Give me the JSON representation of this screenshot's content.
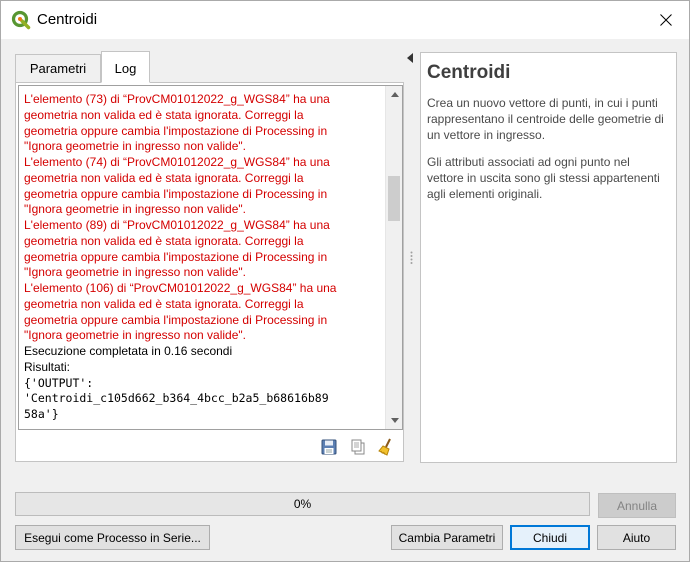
{
  "window": {
    "title": "Centroidi"
  },
  "tabs": [
    {
      "label": "Parametri"
    },
    {
      "label": "Log"
    }
  ],
  "log": {
    "lines": [
      {
        "text": "L'elemento (73) di “ProvCM01012022_g_WGS84” ha una",
        "style": "red"
      },
      {
        "text": "geometria non valida ed è stata ignorata. Correggi la",
        "style": "red"
      },
      {
        "text": "geometria oppure cambia l'impostazione di Processing in",
        "style": "red"
      },
      {
        "text": "\"Ignora geometrie in ingresso non valide\".",
        "style": "red"
      },
      {
        "text": "L'elemento (74) di “ProvCM01012022_g_WGS84” ha una",
        "style": "red"
      },
      {
        "text": "geometria non valida ed è stata ignorata. Correggi la",
        "style": "red"
      },
      {
        "text": "geometria oppure cambia l'impostazione di Processing in",
        "style": "red"
      },
      {
        "text": "\"Ignora geometrie in ingresso non valide\".",
        "style": "red"
      },
      {
        "text": "L'elemento (89) di “ProvCM01012022_g_WGS84” ha una",
        "style": "red"
      },
      {
        "text": "geometria non valida ed è stata ignorata. Correggi la",
        "style": "red"
      },
      {
        "text": "geometria oppure cambia l'impostazione di Processing in",
        "style": "red"
      },
      {
        "text": "\"Ignora geometrie in ingresso non valide\".",
        "style": "red"
      },
      {
        "text": "L'elemento (106) di “ProvCM01012022_g_WGS84” ha una",
        "style": "red"
      },
      {
        "text": "geometria non valida ed è stata ignorata. Correggi la",
        "style": "red"
      },
      {
        "text": "geometria oppure cambia l'impostazione di Processing in",
        "style": "red"
      },
      {
        "text": "\"Ignora geometrie in ingresso non valide\".",
        "style": "red"
      },
      {
        "text": "Esecuzione completata in 0.16 secondi",
        "style": "normal"
      },
      {
        "text": "Risultati:",
        "style": "normal"
      },
      {
        "text": "{'OUTPUT':",
        "style": "mono"
      },
      {
        "text": "'Centroidi_c105d662_b364_4bcc_b2a5_b68616b89",
        "style": "mono"
      },
      {
        "text": "58a'}",
        "style": "mono"
      }
    ]
  },
  "help": {
    "title": "Centroidi",
    "paragraphs": [
      "Crea un nuovo vettore di punti, in cui i punti rappresentano il centroide delle geometrie di un vettore in ingresso.",
      "Gli attributi associati ad ogni punto nel vettore in uscita sono gli stessi appartenenti agli elementi originali."
    ]
  },
  "progress": {
    "value": 0,
    "label": "0%"
  },
  "buttons": {
    "cancel": "Annulla",
    "batch": "Esegui come Processo in Serie...",
    "change_params": "Cambia Parametri",
    "close": "Chiudi",
    "help": "Aiuto"
  },
  "colors": {
    "log_error": "#d40000",
    "progress_fill": "#06b025",
    "accent": "#0078d7"
  }
}
